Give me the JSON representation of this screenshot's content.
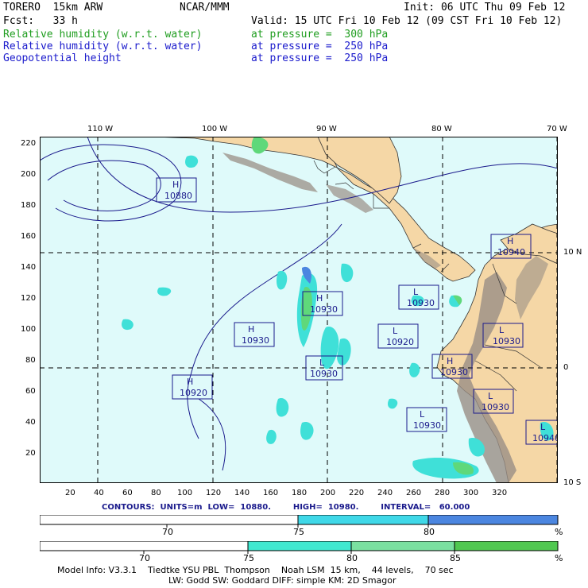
{
  "header": {
    "model": "TORERO  15km ARW",
    "center": "NCAR/MMM",
    "init": "Init: 06 UTC Thu 09 Feb 12",
    "fcst": "Fcst:   33 h",
    "valid": "Valid: 15 UTC Fri 10 Feb 12 (09 CST Fri 10 Feb 12)",
    "fields": [
      {
        "name": "Relative humidity (w.r.t. water)",
        "level": "at pressure =  300 hPa",
        "color": "#1f9d1f"
      },
      {
        "name": "Relative humidity (w.r.t. water)",
        "level": "at pressure =  250 hPa",
        "color": "#1a1acc"
      },
      {
        "name": "Geopotential height",
        "level": "at pressure =  250 hPa",
        "color": "#1a1acc"
      }
    ]
  },
  "map": {
    "lon_labels": [
      "110 W",
      "100 W",
      "90 W",
      "80 W",
      "70 W"
    ],
    "lat_labels": [
      "10 N",
      "0",
      "10 S"
    ],
    "y_ticks": [
      "220",
      "200",
      "180",
      "160",
      "140",
      "120",
      "100",
      "80",
      "60",
      "40",
      "20"
    ],
    "x_ticks": [
      "20",
      "40",
      "60",
      "80",
      "100",
      "120",
      "140",
      "160",
      "180",
      "200",
      "220",
      "240",
      "260",
      "280",
      "300",
      "320"
    ],
    "colors": {
      "ocean": "#dffafa",
      "land": "#f5d7a6",
      "terrain": "#9a8f86",
      "contour": "#1a1a8c",
      "rh_cyan": "#3fe0d8",
      "rh_green": "#5fd87a",
      "rh_blue": "#4b86e0"
    },
    "pressure_centers": [
      {
        "type": "H",
        "value": "10880"
      },
      {
        "type": "H",
        "value": "10940"
      },
      {
        "type": "H",
        "value": "10930"
      },
      {
        "type": "L",
        "value": "10930"
      },
      {
        "type": "H",
        "value": "10930"
      },
      {
        "type": "L",
        "value": "10920"
      },
      {
        "type": "L",
        "value": "10930"
      },
      {
        "type": "L",
        "value": "10930"
      },
      {
        "type": "H",
        "value": "10930"
      },
      {
        "type": "H",
        "value": "10920"
      },
      {
        "type": "L",
        "value": "10930"
      },
      {
        "type": "L",
        "value": "10930"
      },
      {
        "type": "L",
        "value": "10940"
      }
    ]
  },
  "legend": {
    "contours_text": "CONTOURS:  UNITS=m  LOW=  10880.        HIGH=  10980.        INTERVAL=   60.000",
    "bar1": {
      "colors": [
        "#ffffff",
        "#3fd8e8",
        "#4b86e0"
      ],
      "ticks": [
        "70",
        "75",
        "80"
      ],
      "unit": "%"
    },
    "bar2": {
      "colors": [
        "#ffffff",
        "#40e8d0",
        "#7ae0a0",
        "#50c850"
      ],
      "ticks": [
        "70",
        "75",
        "80",
        "85"
      ],
      "unit": "%"
    }
  },
  "footer": {
    "line1": "Model Info: V3.3.1    Tiedtke YSU PBL  Thompson    Noah LSM  15 km,    44 levels,    70 sec",
    "line2": "LW: Godd SW: Goddard DIFF: simple KM: 2D Smagor"
  }
}
